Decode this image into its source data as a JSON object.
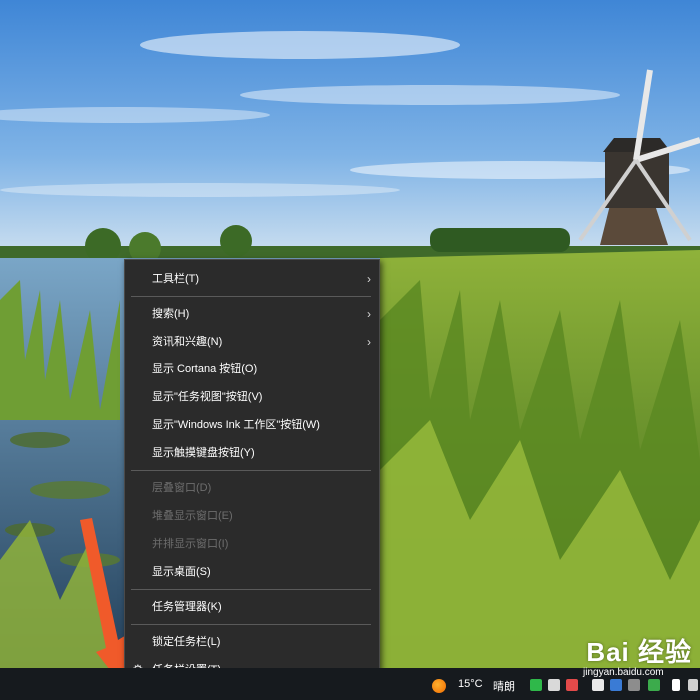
{
  "context_menu": {
    "items": [
      {
        "label": "工具栏(T)"
      },
      {
        "label": "搜索(H)"
      },
      {
        "label": "资讯和兴趣(N)"
      },
      {
        "label": "显示 Cortana 按钮(O)"
      },
      {
        "label": "显示\"任务视图\"按钮(V)"
      },
      {
        "label": "显示\"Windows Ink 工作区\"按钮(W)"
      },
      {
        "label": "显示触摸键盘按钮(Y)"
      },
      {
        "label": "层叠窗口(D)"
      },
      {
        "label": "堆叠显示窗口(E)"
      },
      {
        "label": "并排显示窗口(I)"
      },
      {
        "label": "显示桌面(S)"
      },
      {
        "label": "任务管理器(K)"
      },
      {
        "label": "锁定任务栏(L)"
      },
      {
        "label": "任务栏设置(T)"
      }
    ],
    "submenu_arrow": "›",
    "settings_icon": "⚙"
  },
  "taskbar": {
    "weather": {
      "temperature": "15°C",
      "condition": "晴朗"
    }
  },
  "watermark": {
    "brand": "Bai 经验",
    "url": "jingyan.baidu.com"
  },
  "colors": {
    "menu_bg": "#2b2b2b",
    "menu_text": "#ffffff",
    "menu_disabled": "#6d6d6d",
    "taskbar_bg": "#161a1e",
    "arrow_annotation": "#f05a2a"
  }
}
